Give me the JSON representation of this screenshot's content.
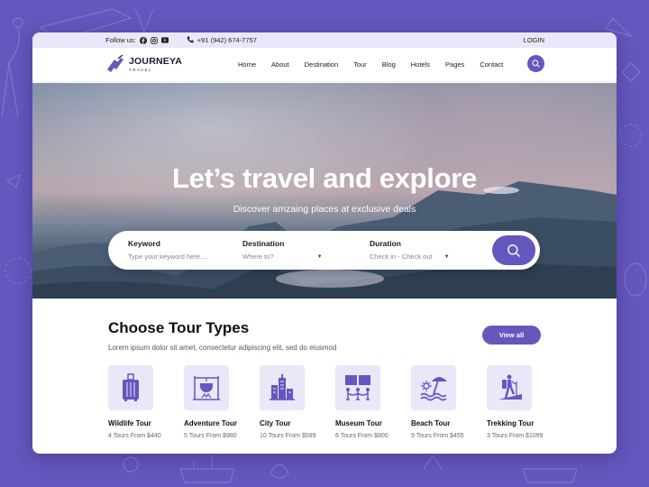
{
  "colors": {
    "brand": "#6457bd",
    "brand_light": "#ebe6f8",
    "background": "#6457bd"
  },
  "topbar": {
    "follow_label": "Follow us:",
    "social": [
      "facebook-icon",
      "instagram-icon",
      "youtube-icon"
    ],
    "phone": "+91 (942) 674-7757",
    "login": "LOGIN"
  },
  "brand": {
    "name": "JOURNEYA",
    "tagline": "TRAVEL"
  },
  "nav": {
    "items": [
      "Home",
      "About",
      "Destination",
      "Tour",
      "Blog",
      "Hotels",
      "Pages",
      "Contact"
    ]
  },
  "hero": {
    "title": "Let’s travel and explore",
    "subtitle": "Discover amzaing places at exclusive deals"
  },
  "search": {
    "keyword": {
      "label": "Keyword",
      "placeholder": "Type your keyword here...."
    },
    "destination": {
      "label": "Destination",
      "placeholder": "Where to?"
    },
    "duration": {
      "label": "Duration",
      "placeholder": "Check in - Check out"
    }
  },
  "tours": {
    "title": "Choose Tour Types",
    "subtitle": "Lorem ipsum dolor sit amet, consectetur adipiscing elit, sed do eiusmod",
    "view_all": "View all",
    "items": [
      {
        "name": "Wildlife Tour",
        "meta": "4 Tours From  $440",
        "icon": "luggage-icon"
      },
      {
        "name": "Adventure Tour",
        "meta": "5 Tours From  $980",
        "icon": "campfire-icon"
      },
      {
        "name": "City Tour",
        "meta": "10 Tours From  $599",
        "icon": "city-icon"
      },
      {
        "name": "Museum Tour",
        "meta": "6 Tours From  $800",
        "icon": "museum-icon"
      },
      {
        "name": "Beach Tour",
        "meta": "9 Tours From  $455",
        "icon": "beach-icon"
      },
      {
        "name": "Trekking Tour",
        "meta": "3 Tours From  $1099",
        "icon": "hiker-icon"
      }
    ]
  }
}
